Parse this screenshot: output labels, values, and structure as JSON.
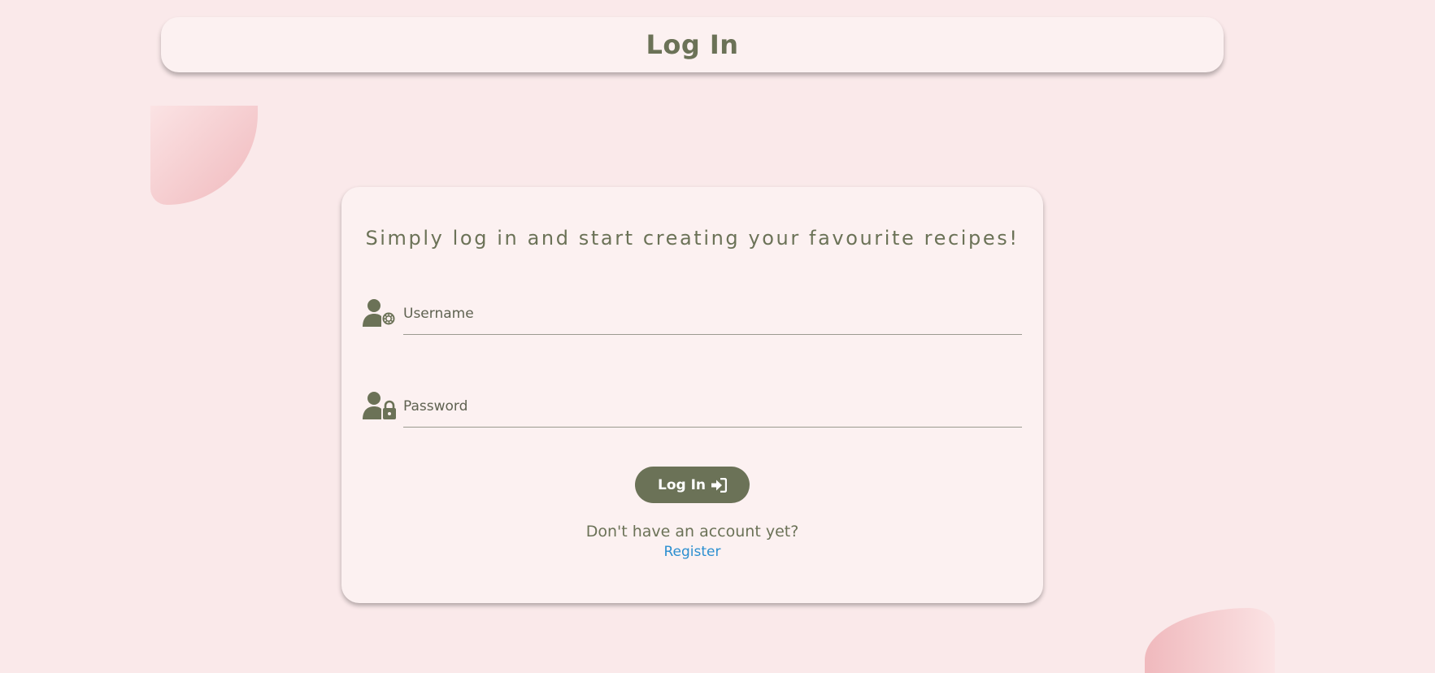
{
  "header": {
    "title": "Log In"
  },
  "card": {
    "tagline": "Simply log in and start creating your favourite recipes!",
    "fields": [
      {
        "label": "Username",
        "icon": "user-gear-icon"
      },
      {
        "label": "Password",
        "icon": "user-lock-icon"
      }
    ],
    "login_button": {
      "label": "Log In",
      "icon": "sign-in-icon"
    },
    "prompt": "Don't have an account yet?",
    "register_link": "Register"
  },
  "colors": {
    "background": "#fae9ea",
    "surface": "#fcf1f1",
    "accent": "#6b7257",
    "link": "#2b8fd0",
    "decoration": "#f0b9bd"
  }
}
